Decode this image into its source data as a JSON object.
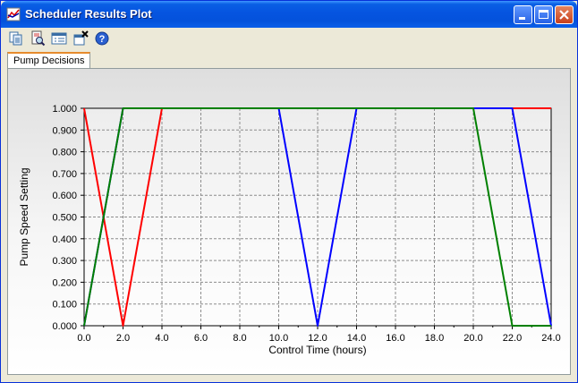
{
  "window": {
    "title": "Scheduler Results Plot"
  },
  "toolbar": {
    "icons": [
      "copy-icon",
      "print-preview-icon",
      "properties-icon",
      "export-icon",
      "help-icon"
    ]
  },
  "tabs": [
    {
      "label": "Pump Decisions",
      "active": true
    }
  ],
  "colors": {
    "accent_tab": "#e68b2c",
    "series_red": "#ff0000",
    "series_blue": "#0000ff",
    "series_green": "#008000"
  },
  "chart_data": {
    "type": "line",
    "xlabel": "Control Time (hours)",
    "ylabel": "Pump Speed Setting",
    "xlim": [
      0,
      24
    ],
    "ylim": [
      0,
      1
    ],
    "x_ticks": [
      "0.0",
      "2.0",
      "4.0",
      "6.0",
      "8.0",
      "10.0",
      "12.0",
      "14.0",
      "16.0",
      "18.0",
      "20.0",
      "22.0",
      "24.0"
    ],
    "y_ticks": [
      "0.000",
      "0.100",
      "0.200",
      "0.300",
      "0.400",
      "0.500",
      "0.600",
      "0.700",
      "0.800",
      "0.900",
      "1.000"
    ],
    "grid": true,
    "series": [
      {
        "color": "#ff0000",
        "x": [
          0,
          2,
          4,
          24
        ],
        "y": [
          1,
          0,
          1,
          1
        ]
      },
      {
        "color": "#0000ff",
        "x": [
          0,
          2,
          10,
          12,
          14,
          22,
          24
        ],
        "y": [
          0,
          1,
          1,
          0,
          1,
          1,
          0
        ]
      },
      {
        "color": "#008000",
        "x": [
          0,
          2,
          20,
          22,
          24
        ],
        "y": [
          0,
          1,
          1,
          0,
          0
        ]
      }
    ]
  }
}
